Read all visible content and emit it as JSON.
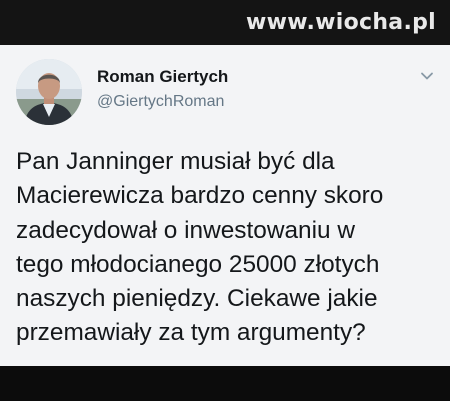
{
  "watermark": "www.wiocha.pl",
  "tweet": {
    "display_name": "Roman Giertych",
    "handle": "@GiertychRoman",
    "text": "Pan Janninger musiał być dla\nMacierewicza bardzo cenny skoro\nzadecydował o inwestowaniu w\ntego młodocianego 25000 złotych\nnaszych pieniędzy. Ciekawe jakie\nprzemawiały za tym argumenty?"
  },
  "icons": {
    "menu": "chevron-down-icon",
    "avatar": "profile-photo"
  },
  "colors": {
    "card_background": "#f3f4f6",
    "text_primary": "#14171a",
    "text_secondary": "#657786",
    "frame": "#0f0f0f"
  }
}
